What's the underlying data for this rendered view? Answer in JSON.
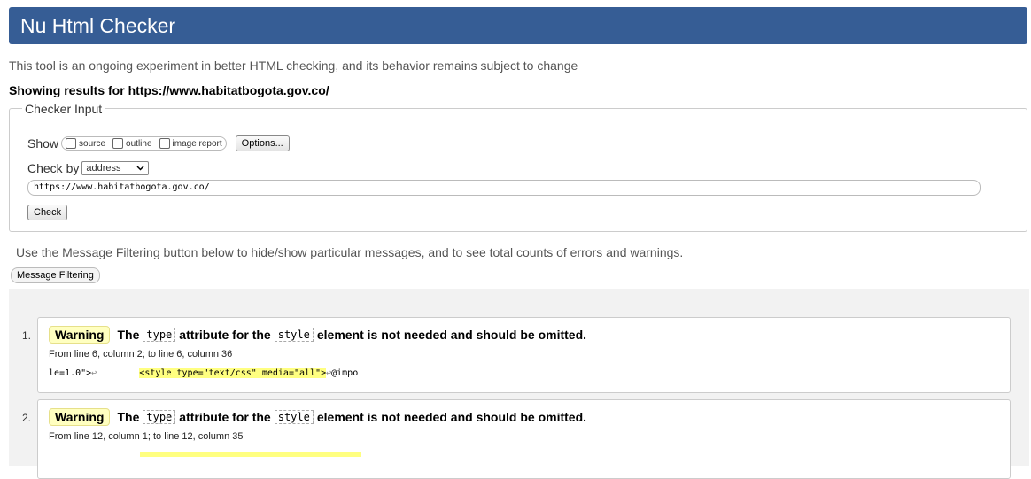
{
  "header": {
    "title": "Nu Html Checker"
  },
  "intro": "This tool is an ongoing experiment in better HTML checking, and its behavior remains subject to change",
  "showing": "Showing results for https://www.habitatbogota.gov.co/",
  "checker": {
    "legend": "Checker Input",
    "show_label": "Show",
    "show_options": [
      "source",
      "outline",
      "image report"
    ],
    "options_button": "Options...",
    "check_by_label": "Check by",
    "check_by_value": "address",
    "url_value": "https://www.habitatbogota.gov.co/",
    "check_button": "Check"
  },
  "filter": {
    "text": "Use the Message Filtering button below to hide/show particular messages, and to see total counts of errors and warnings.",
    "button": "Message Filtering"
  },
  "messages": [
    {
      "num": "1.",
      "badge": "Warning",
      "pre": "The",
      "code1": "type",
      "mid": "attribute for the",
      "code2": "style",
      "post": "element is not needed and should be omitted.",
      "location": "From line 6, column 2; to line 6, column 36",
      "extract_before": "le=1.0\">",
      "extract_hl": "<style type=\"text/css\" media=\"all\">",
      "extract_after": "@impo"
    },
    {
      "num": "2.",
      "badge": "Warning",
      "pre": "The",
      "code1": "type",
      "mid": "attribute for the",
      "code2": "style",
      "post": "element is not needed and should be omitted.",
      "location": "From line 12, column 1; to line 12, column 35"
    }
  ],
  "colors": {
    "banner": "#365d95",
    "warning_badge": "#ffffc0",
    "highlight": "#ffff80"
  }
}
